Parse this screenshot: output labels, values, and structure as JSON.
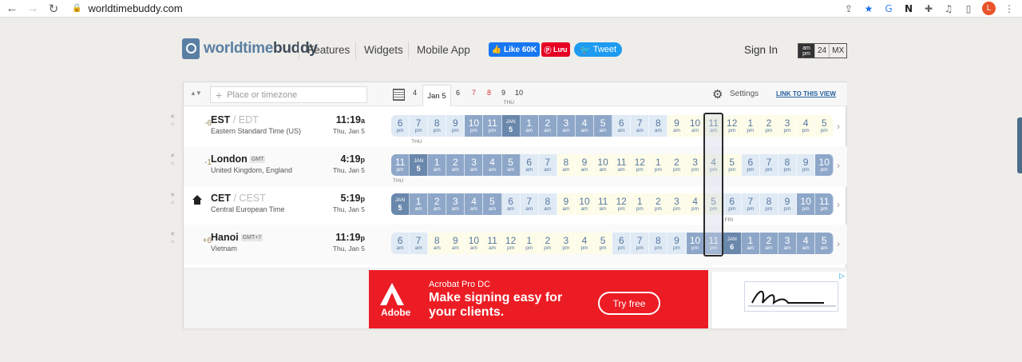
{
  "browser": {
    "url": "worldtimebuddy.com",
    "profile": "L"
  },
  "site": {
    "logo_a": "worldtime",
    "logo_b": "buddy",
    "nav": [
      "Features",
      "Widgets",
      "Mobile App"
    ],
    "fb_like": "Like 60K",
    "pin": "Lưu",
    "tweet": "Tweet",
    "signin": "Sign In",
    "format": {
      "ampm": "am pm",
      "h24": "24",
      "mx": "MX"
    }
  },
  "toolbar": {
    "placeholder": "Place or timezone",
    "day_tabs": [
      "4",
      "Jan 5",
      "6",
      "7",
      "8",
      "9",
      "10"
    ],
    "settings": "Settings",
    "link_view": "LINK TO THIS VIEW"
  },
  "zones": [
    {
      "offset": "-6",
      "abbr": "EST",
      "alt": "/ EDT",
      "badge": "",
      "desc": "Eastern Standard Time (US)",
      "time": "11:19",
      "ampm": "a",
      "date": "Thu, Jan 5",
      "home": false,
      "label": "THU",
      "label_index": 6,
      "cells": [
        [
          "6",
          "pm",
          "eve"
        ],
        [
          "7",
          "pm",
          "eve"
        ],
        [
          "8",
          "pm",
          "eve"
        ],
        [
          "9",
          "pm",
          "eve"
        ],
        [
          "10",
          "pm",
          "night"
        ],
        [
          "11",
          "pm",
          "night"
        ],
        [
          "JAN",
          "5",
          "date"
        ],
        [
          "1",
          "am",
          "night"
        ],
        [
          "2",
          "am",
          "night"
        ],
        [
          "3",
          "am",
          "night"
        ],
        [
          "4",
          "am",
          "night"
        ],
        [
          "5",
          "am",
          "night"
        ],
        [
          "6",
          "am",
          "morn"
        ],
        [
          "7",
          "am",
          "morn"
        ],
        [
          "8",
          "am",
          "morn"
        ],
        [
          "9",
          "am",
          "day"
        ],
        [
          "10",
          "am",
          "day"
        ],
        [
          "11",
          "am",
          "day"
        ],
        [
          "12",
          "pm",
          "day"
        ],
        [
          "1",
          "pm",
          "day"
        ],
        [
          "2",
          "pm",
          "day"
        ],
        [
          "3",
          "pm",
          "day"
        ],
        [
          "4",
          "pm",
          "day"
        ],
        [
          "5",
          "pm",
          "day"
        ]
      ]
    },
    {
      "offset": "-1",
      "abbr": "London",
      "alt": "",
      "badge": "GMT",
      "desc": "United Kingdom, England",
      "time": "4:19",
      "ampm": "p",
      "date": "Thu, Jan 5",
      "home": false,
      "label": "THU",
      "label_index": 1,
      "cells": [
        [
          "11",
          "pm",
          "night"
        ],
        [
          "JAN",
          "5",
          "date"
        ],
        [
          "1",
          "am",
          "night"
        ],
        [
          "2",
          "am",
          "night"
        ],
        [
          "3",
          "am",
          "night"
        ],
        [
          "4",
          "am",
          "night"
        ],
        [
          "5",
          "am",
          "night"
        ],
        [
          "6",
          "am",
          "morn"
        ],
        [
          "7",
          "am",
          "morn"
        ],
        [
          "8",
          "am",
          "day"
        ],
        [
          "9",
          "am",
          "day"
        ],
        [
          "10",
          "am",
          "day"
        ],
        [
          "11",
          "am",
          "day"
        ],
        [
          "12",
          "pm",
          "day"
        ],
        [
          "1",
          "pm",
          "day"
        ],
        [
          "2",
          "pm",
          "day"
        ],
        [
          "3",
          "pm",
          "day"
        ],
        [
          "4",
          "pm",
          "day"
        ],
        [
          "5",
          "pm",
          "day"
        ],
        [
          "6",
          "pm",
          "eve"
        ],
        [
          "7",
          "pm",
          "eve"
        ],
        [
          "8",
          "pm",
          "eve"
        ],
        [
          "9",
          "pm",
          "eve"
        ],
        [
          "10",
          "pm",
          "night"
        ]
      ]
    },
    {
      "offset": "",
      "abbr": "CET",
      "alt": "/ CEST",
      "badge": "",
      "desc": "Central European Time",
      "time": "5:19",
      "ampm": "p",
      "date": "Thu, Jan 5",
      "home": true,
      "label": "THU",
      "label_index": 0,
      "cells": [
        [
          "JAN",
          "5",
          "date"
        ],
        [
          "1",
          "am",
          "night"
        ],
        [
          "2",
          "am",
          "night"
        ],
        [
          "3",
          "am",
          "night"
        ],
        [
          "4",
          "am",
          "night"
        ],
        [
          "5",
          "am",
          "night"
        ],
        [
          "6",
          "am",
          "morn"
        ],
        [
          "7",
          "am",
          "morn"
        ],
        [
          "8",
          "am",
          "morn"
        ],
        [
          "9",
          "am",
          "day"
        ],
        [
          "10",
          "am",
          "day"
        ],
        [
          "11",
          "am",
          "day"
        ],
        [
          "12",
          "pm",
          "day"
        ],
        [
          "1",
          "pm",
          "day"
        ],
        [
          "2",
          "pm",
          "day"
        ],
        [
          "3",
          "pm",
          "day"
        ],
        [
          "4",
          "pm",
          "day"
        ],
        [
          "5",
          "pm",
          "day"
        ],
        [
          "6",
          "pm",
          "eve"
        ],
        [
          "7",
          "pm",
          "eve"
        ],
        [
          "8",
          "pm",
          "eve"
        ],
        [
          "9",
          "pm",
          "eve"
        ],
        [
          "10",
          "pm",
          "night"
        ],
        [
          "11",
          "pm",
          "night"
        ]
      ]
    },
    {
      "offset": "+6",
      "abbr": "Hanoi",
      "alt": "",
      "badge": "GMT+7",
      "desc": "Vietnam",
      "time": "11:19",
      "ampm": "p",
      "date": "Thu, Jan 5",
      "home": false,
      "label": "FRI",
      "label_index": 18,
      "cells": [
        [
          "6",
          "am",
          "morn"
        ],
        [
          "7",
          "am",
          "morn"
        ],
        [
          "8",
          "am",
          "day"
        ],
        [
          "9",
          "am",
          "day"
        ],
        [
          "10",
          "am",
          "day"
        ],
        [
          "11",
          "am",
          "day"
        ],
        [
          "12",
          "pm",
          "day"
        ],
        [
          "1",
          "pm",
          "day"
        ],
        [
          "2",
          "pm",
          "day"
        ],
        [
          "3",
          "pm",
          "day"
        ],
        [
          "4",
          "pm",
          "day"
        ],
        [
          "5",
          "pm",
          "day"
        ],
        [
          "6",
          "pm",
          "eve"
        ],
        [
          "7",
          "pm",
          "eve"
        ],
        [
          "8",
          "pm",
          "eve"
        ],
        [
          "9",
          "pm",
          "eve"
        ],
        [
          "10",
          "pm",
          "night"
        ],
        [
          "11",
          "pm",
          "night"
        ],
        [
          "JAN",
          "6",
          "date"
        ],
        [
          "1",
          "am",
          "night"
        ],
        [
          "2",
          "am",
          "night"
        ],
        [
          "3",
          "am",
          "night"
        ],
        [
          "4",
          "am",
          "night"
        ],
        [
          "5",
          "am",
          "night"
        ]
      ]
    }
  ],
  "ad": {
    "brand": "Adobe",
    "product": "Acrobat Pro DC",
    "headline": "Make signing easy for your clients.",
    "cta": "Try free"
  }
}
